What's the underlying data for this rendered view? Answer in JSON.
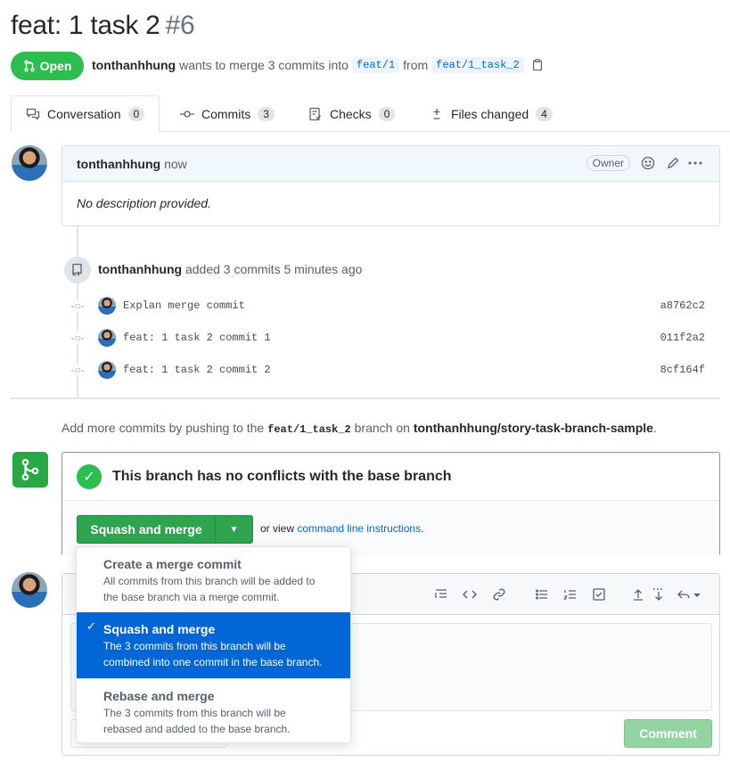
{
  "pr": {
    "title": "feat: 1 task 2",
    "number": "#6",
    "state": "Open",
    "author": "tonthanhhung",
    "wants_text": "wants to merge 3 commits into",
    "base_branch": "feat/1",
    "from_text": "from",
    "head_branch": "feat/1_task_2"
  },
  "tabs": [
    {
      "label": "Conversation",
      "count": "0"
    },
    {
      "label": "Commits",
      "count": "3"
    },
    {
      "label": "Checks",
      "count": "0"
    },
    {
      "label": "Files changed",
      "count": "4"
    }
  ],
  "comment": {
    "author": "tonthanhhung",
    "time": "now",
    "role": "Owner",
    "body": "No description provided."
  },
  "push_event": {
    "author": "tonthanhhung",
    "text": "added 3 commits 5 minutes ago"
  },
  "commits": [
    {
      "message": "Explan merge commit",
      "sha": "a8762c2"
    },
    {
      "message": "feat: 1 task 2 commit 1",
      "sha": "011f2a2"
    },
    {
      "message": "feat: 1 task 2 commit 2",
      "sha": "8cf164f"
    }
  ],
  "hint": {
    "prefix": "Add more commits by pushing to the",
    "branch": "feat/1_task_2",
    "middle": "branch on",
    "repo": "tonthanhhung/story-task-branch-sample",
    "suffix": "."
  },
  "merge": {
    "status": "This branch has no conflicts with the base branch",
    "button_label": "Squash and merge",
    "or_view": "or view",
    "cli_link": "command line instructions",
    "cli_suffix": "."
  },
  "merge_options": [
    {
      "title": "Create a merge commit",
      "desc1": "All commits from this branch will be added to",
      "desc2": "the base branch via a merge commit.",
      "selected": false
    },
    {
      "title": "Squash and merge",
      "desc1": "The 3 commits from this branch will be",
      "desc2": "combined into one commit in the base branch.",
      "selected": true
    },
    {
      "title": "Rebase and merge",
      "desc1": "The 3 commits from this branch will be",
      "desc2": "rebased and added to the base branch.",
      "selected": false
    }
  ],
  "new_comment": {
    "submit_label": "Comment"
  },
  "icons": {
    "open": "git-pull-request-icon",
    "clipboard": "clipboard-icon",
    "conversation": "comment-discussion-icon",
    "commits": "git-commit-icon",
    "checks": "checklist-icon",
    "files": "diff-icon",
    "smiley": "smiley-icon",
    "pencil": "pencil-icon",
    "kebab": "kebab-horizontal-icon",
    "push": "repo-push-icon",
    "merge": "git-merge-icon",
    "check": "check-icon"
  },
  "colors": {
    "open_green": "#2cbe4e",
    "merge_button": "#2ea44f",
    "link_blue": "#0366d6",
    "selected_blue": "#0366d6",
    "comment_button_disabled": "#94d3a2"
  }
}
